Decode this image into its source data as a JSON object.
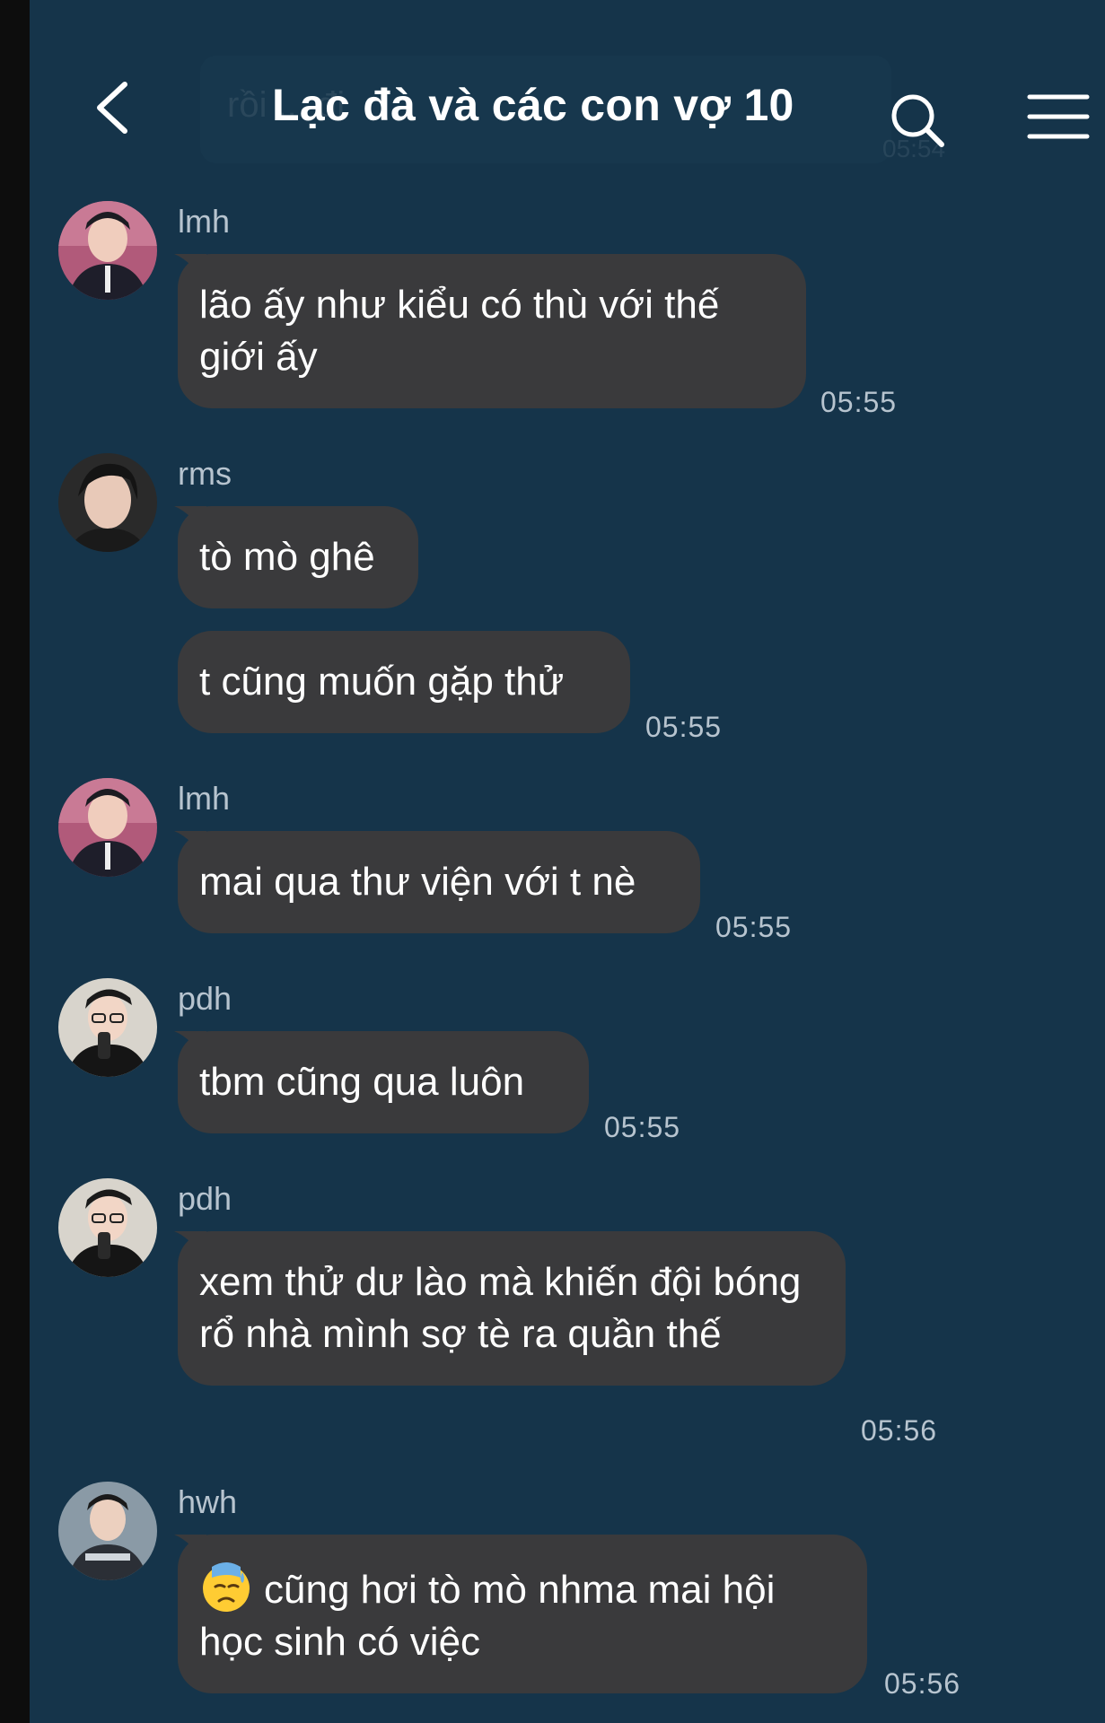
{
  "header": {
    "title": "Lạc đà và các con vợ 10",
    "ghost_text": "rồi ... đi",
    "ghost_time": "05:54"
  },
  "messages": [
    {
      "sender": "lmh",
      "text": "lão ấy như kiểu có thù với thế giới ấy",
      "time": "05:55"
    },
    {
      "sender": "rms",
      "text": "tò mò ghê",
      "time": ""
    },
    {
      "sender": "",
      "text": "t cũng muốn gặp thử",
      "time": "05:55"
    },
    {
      "sender": "lmh",
      "text": "mai qua thư viện với t nè",
      "time": "05:55"
    },
    {
      "sender": "pdh",
      "text": "tbm cũng qua luôn",
      "time": "05:55"
    },
    {
      "sender": "pdh",
      "text": "xem thử dư lào mà khiến đội bóng rổ nhà mình sợ tè ra quần thế",
      "time": "05:56"
    },
    {
      "sender": "hwh",
      "text": "cũng hơi tò mò nhma mai hội học sinh có việc",
      "emoji": "downcast-sweat-face",
      "time": "05:56"
    }
  ],
  "colors": {
    "background": "#15344a",
    "bubble": "#3a3a3c",
    "text": "#ffffff",
    "meta": "#b7c4cf"
  }
}
